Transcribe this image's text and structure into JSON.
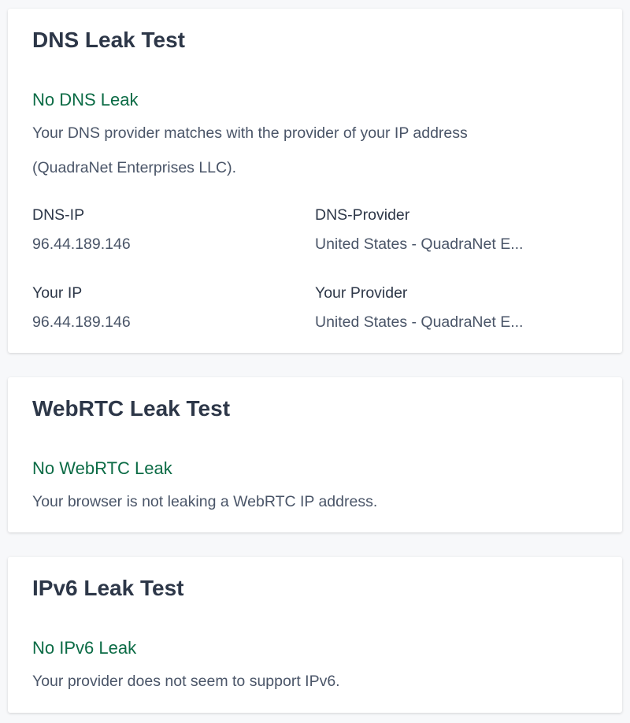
{
  "dns": {
    "title": "DNS Leak Test",
    "status": "No DNS Leak",
    "description": "Your DNS provider matches with the provider of your IP address (QuadraNet Enterprises LLC).",
    "fields": [
      {
        "label": "DNS-IP",
        "value": "96.44.189.146"
      },
      {
        "label": "DNS-Provider",
        "value": "United States - QuadraNet E..."
      },
      {
        "label": "Your IP",
        "value": "96.44.189.146"
      },
      {
        "label": "Your Provider",
        "value": "United States - QuadraNet E..."
      }
    ]
  },
  "webrtc": {
    "title": "WebRTC Leak Test",
    "status": "No WebRTC Leak",
    "description": "Your browser is not leaking a WebRTC IP address."
  },
  "ipv6": {
    "title": "IPv6 Leak Test",
    "status": "No IPv6 Leak",
    "description": "Your provider does not seem to support IPv6."
  },
  "colors": {
    "status_ok": "#0b6b45",
    "heading": "#2d3748",
    "body": "#4a5568"
  }
}
